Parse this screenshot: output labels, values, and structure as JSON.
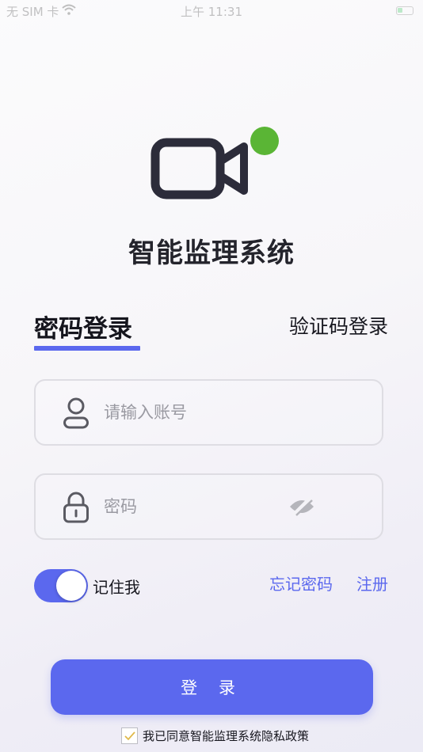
{
  "status_bar": {
    "carrier": "无 SIM 卡",
    "time": "上午 11:31",
    "icons": [
      "wifi-icon",
      "battery-icon"
    ]
  },
  "logo": {
    "icon": "video-camera-icon",
    "status_color": "#5ab535"
  },
  "app_title": "智能监理系统",
  "tabs": {
    "password_login": "密码登录",
    "code_login": "验证码登录",
    "active": "password_login"
  },
  "form": {
    "account": {
      "placeholder": "请输入账号",
      "value": "",
      "icon": "user-icon"
    },
    "password": {
      "placeholder": "密码",
      "value": "",
      "icon": "lock-icon",
      "toggle_icon": "eye-off-icon"
    }
  },
  "options": {
    "remember_me": "记住我",
    "remember_me_on": true,
    "forgot_password": "忘记密码",
    "register": "注册"
  },
  "login_button": "登 录",
  "agreement": {
    "checked": true,
    "text": "我已同意智能监理系统隐私政策"
  },
  "colors": {
    "accent": "#5b68ee",
    "text": "#16161e",
    "icon_dark": "#2c2c3a"
  }
}
